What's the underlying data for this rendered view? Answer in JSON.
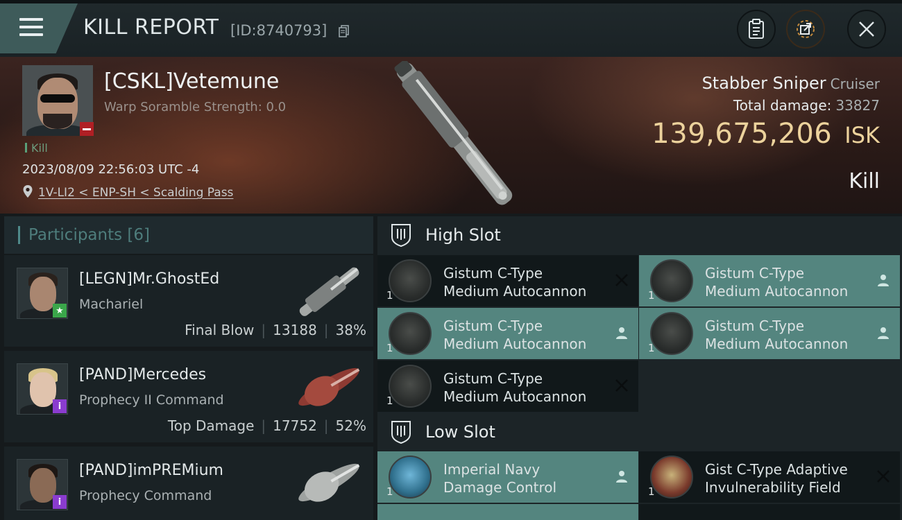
{
  "header": {
    "title": "KILL REPORT",
    "report_id": "[ID:8740793]"
  },
  "victim": {
    "name": "[CSKL]Vetemune",
    "warp_scramble": "Warp Soramble Strength: 0.0",
    "tag": "Kill",
    "datetime": "2023/08/09 22:56:03 UTC -4",
    "location": "1V-LI2 < ENP-SH < Scalding Pass",
    "ship_name": "Stabber Sniper",
    "ship_class": "Cruiser",
    "total_damage_label": "Total damage:",
    "total_damage": "33827",
    "isk_value": "139,675,206",
    "isk_unit": "ISK",
    "kill_type": "Kill"
  },
  "participants": {
    "label": "Participants",
    "count": "[6]",
    "items": [
      {
        "name": "[LEGN]Mr.GhostEd",
        "ship": "Machariel",
        "role": "Final Blow",
        "damage": "13188",
        "percent": "38%",
        "badge": "★",
        "badge_color": "#3aa64a"
      },
      {
        "name": "[PAND]Mercedes",
        "ship": "Prophecy II Command",
        "role": "Top Damage",
        "damage": "17752",
        "percent": "52%",
        "badge": "i",
        "badge_color": "#8a3ccf"
      },
      {
        "name": "[PAND]imPREMium",
        "ship": "Prophecy Command",
        "role": "",
        "damage": "",
        "percent": "",
        "badge": "i",
        "badge_color": "#8a3ccf"
      }
    ]
  },
  "slots": {
    "high": {
      "label": "High Slot",
      "modules": [
        {
          "qty": "1",
          "line1": "Gistum C-Type",
          "line2": "Medium Autocannon",
          "state": "close-icon",
          "highlight": false
        },
        {
          "qty": "1",
          "line1": "Gistum C-Type",
          "line2": "Medium Autocannon",
          "state": "person-icon",
          "highlight": true
        },
        {
          "qty": "1",
          "line1": "Gistum C-Type",
          "line2": "Medium Autocannon",
          "state": "person-icon",
          "highlight": true
        },
        {
          "qty": "1",
          "line1": "Gistum C-Type",
          "line2": "Medium Autocannon",
          "state": "person-icon",
          "highlight": true
        },
        {
          "qty": "1",
          "line1": "Gistum C-Type",
          "line2": "Medium Autocannon",
          "state": "close-icon",
          "highlight": false
        }
      ]
    },
    "low": {
      "label": "Low Slot",
      "modules": [
        {
          "qty": "1",
          "line1": "Imperial Navy",
          "line2": "Damage Control",
          "state": "person-icon",
          "highlight": true
        },
        {
          "qty": "1",
          "line1": "Gist C-Type Adaptive",
          "line2": "Invulnerability Field",
          "state": "close-icon",
          "highlight": false
        }
      ]
    }
  },
  "colors": {
    "accent_teal": "#54857f",
    "isk_gold": "#ecd29c",
    "kill_green": "#6c9c7e"
  }
}
